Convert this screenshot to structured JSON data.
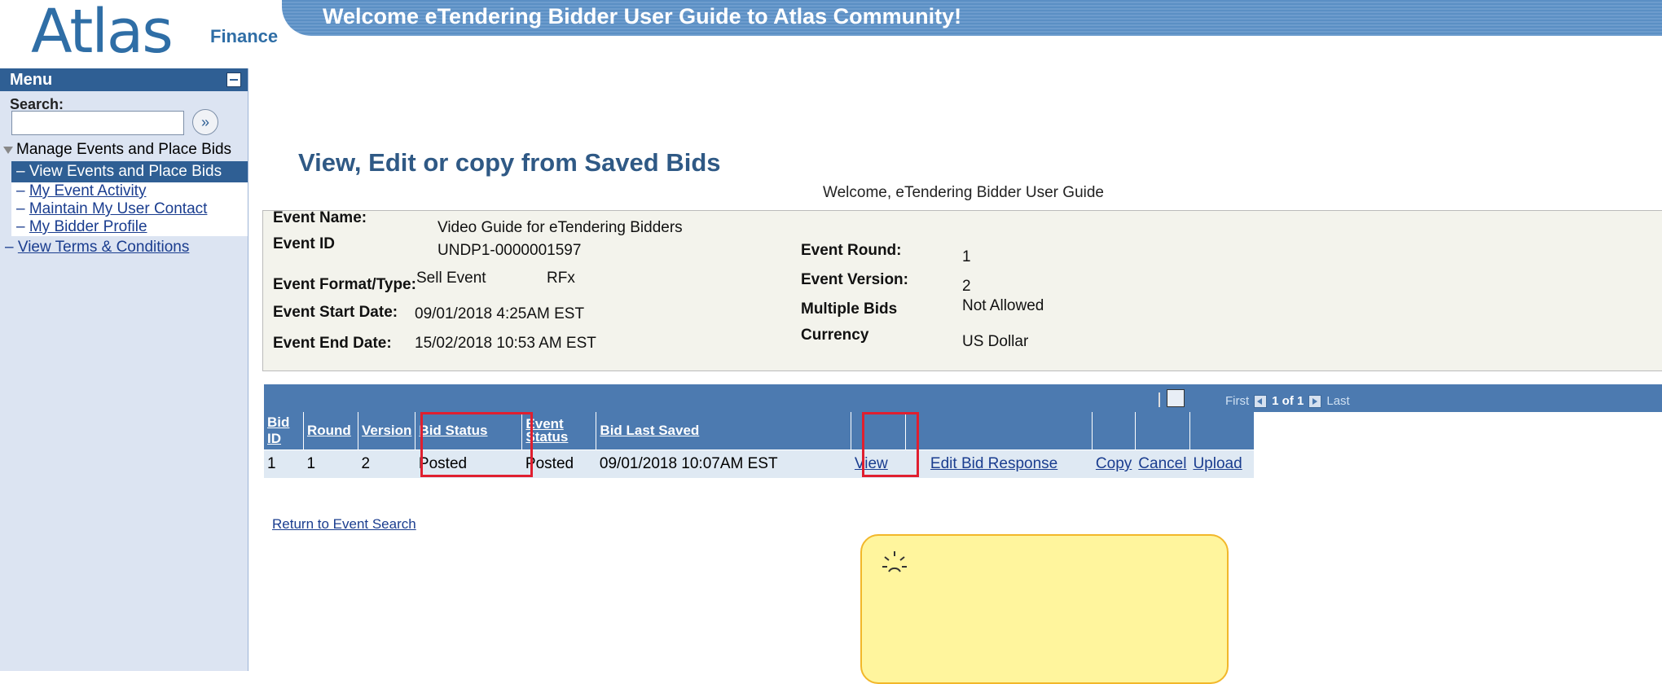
{
  "header": {
    "logo_word": "Atlas",
    "logo_sub": "Finance",
    "banner": "Welcome eTendering Bidder User Guide to Atlas Community!"
  },
  "sidebar": {
    "menu_title": "Menu",
    "search_label": "Search:",
    "search_value": "",
    "group_label": "Manage Events and Place Bids",
    "items": [
      {
        "label": "View Events and Place Bids",
        "active": true
      },
      {
        "label": "My Event Activity",
        "active": false
      },
      {
        "label": "Maintain My User Contact",
        "active": false
      },
      {
        "label": "My Bidder Profile",
        "active": false
      }
    ],
    "top_item": "View Terms & Conditions"
  },
  "main": {
    "title": "View, Edit or copy from Saved Bids",
    "welcome": "Welcome, eTendering Bidder User Guide",
    "event": {
      "name_label": "Event Name:",
      "name": "Video Guide for eTendering Bidders",
      "id_label": "Event ID",
      "id": "UNDP1-0000001597",
      "format_label": "Event Format/Type:",
      "format": "Sell Event",
      "type": "RFx",
      "start_label": "Event Start Date:",
      "start": "09/01/2018  4:25AM EST",
      "end_label": "Event End Date:",
      "end": "15/02/2018 10:53 AM EST",
      "round_label": "Event Round:",
      "round": "1",
      "version_label": "Event Version:",
      "version": "2",
      "multi_label": "Multiple Bids",
      "multi": "Not Allowed",
      "currency_label": "Currency",
      "currency": "US Dollar"
    },
    "grid": {
      "nav_first": "First",
      "nav_count": "1 of 1",
      "nav_last": "Last",
      "headers": [
        "Bid ID",
        "Round",
        "Version",
        "Bid Status",
        "Event Status",
        "Bid Last Saved"
      ],
      "row": {
        "bid_id": "1",
        "round": "1",
        "version": "2",
        "bid_status": "Posted",
        "event_status": "Posted",
        "last_saved": "09/01/2018 10:07AM EST",
        "view": "View",
        "edit": "Edit Bid Response",
        "copy": "Copy",
        "cancel": "Cancel",
        "upload": "Upload"
      }
    },
    "return_link": "Return to Event Search"
  },
  "colors": {
    "highlight": "#e01f2f",
    "callout_bg": "#fff59d",
    "grid_head": "#4c7ab0"
  }
}
